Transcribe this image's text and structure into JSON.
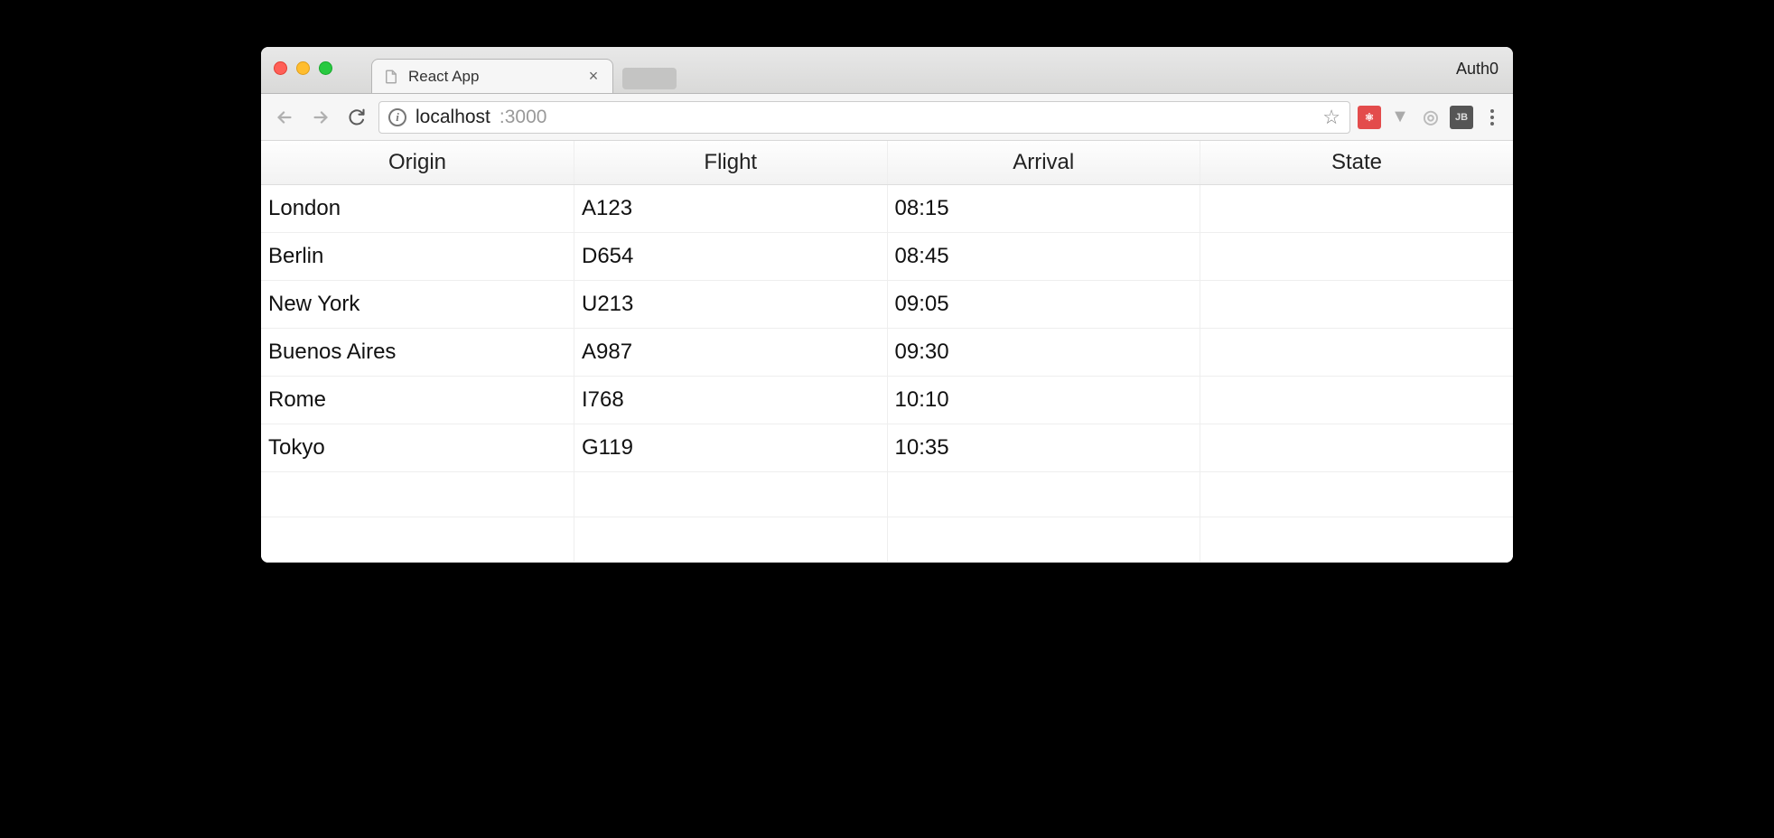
{
  "browser": {
    "tab_title": "React App",
    "profile_name": "Auth0",
    "url_host": "localhost",
    "url_port": ":3000"
  },
  "icons": {
    "info": "i",
    "star": "☆",
    "close_x": "×",
    "ext_react": "⚛",
    "ext_vue": "▼",
    "ext_circle": "◎",
    "ext_jb": "JB"
  },
  "table": {
    "headers": [
      "Origin",
      "Flight",
      "Arrival",
      "State"
    ],
    "rows": [
      {
        "origin": "London",
        "flight": "A123",
        "arrival": "08:15",
        "state": ""
      },
      {
        "origin": "Berlin",
        "flight": "D654",
        "arrival": "08:45",
        "state": ""
      },
      {
        "origin": "New York",
        "flight": "U213",
        "arrival": "09:05",
        "state": ""
      },
      {
        "origin": "Buenos Aires",
        "flight": "A987",
        "arrival": "09:30",
        "state": ""
      },
      {
        "origin": "Rome",
        "flight": "I768",
        "arrival": "10:10",
        "state": ""
      },
      {
        "origin": "Tokyo",
        "flight": "G119",
        "arrival": "10:35",
        "state": ""
      },
      {
        "origin": "",
        "flight": "",
        "arrival": "",
        "state": ""
      },
      {
        "origin": "",
        "flight": "",
        "arrival": "",
        "state": ""
      }
    ]
  }
}
